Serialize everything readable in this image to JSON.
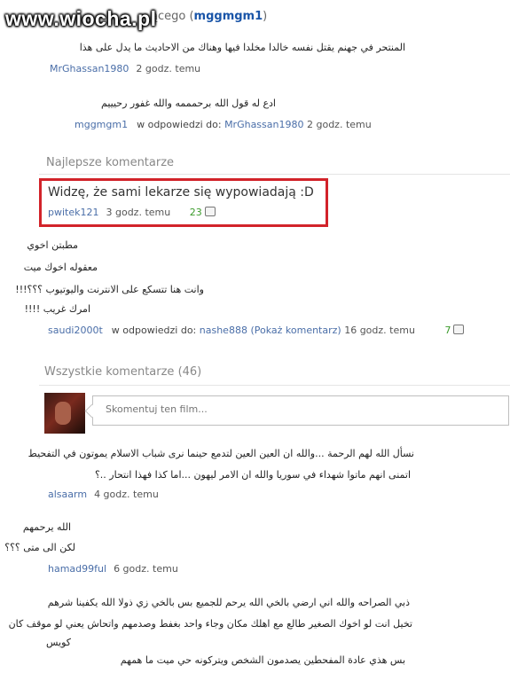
{
  "watermark": "www.wiocha.pl",
  "top": {
    "prefix": "ącego",
    "user": "mggmgm1",
    "paren_open": "(",
    "paren_close": ")"
  },
  "comments_top": [
    {
      "text": "المنتحر في جهنم يقتل نفسه خالدا مخلدا فيها وهناك من الاحاديث ما يدل على هذا",
      "user": "MrGhassan1980",
      "time": "2 godz. temu"
    },
    {
      "text": "ادع له قول الله برحمممه والله غفور رحيييم",
      "user": "mggmgm1",
      "reply_label": "w odpowiedzi do:",
      "reply_to": "MrGhassan1980",
      "time": "2 godz. temu"
    }
  ],
  "best": {
    "heading": "Najlepsze komentarze",
    "highlight": {
      "text": "Widzę, że sami lekarze się wypowiadają :D",
      "user": "pwitek121",
      "time": "3 godz. temu",
      "likes": "23"
    },
    "comment2": {
      "lines": [
        "مطبتن اخوي",
        "معقوله اخوك ميت",
        "وانت هنا تتسكع على الانترنت واليوتيوب ؟؟؟!!!",
        "امرك غريب !!!!"
      ],
      "user": "saudi2000t",
      "reply_label": "w odpowiedzi do:",
      "reply_to": "nashe888 (Pokaż komentarz)",
      "time": "16 godz. temu",
      "likes": "7"
    }
  },
  "all": {
    "heading": "Wszystkie komentarze (46)",
    "input_placeholder": "Skomentuj ten film...",
    "comments": [
      {
        "lines": [
          "نسأل الله لهم الرحمة ...والله ان العين العين لتدمع حينما نرى شباب الاسلام يموتون في التفحيط",
          "اتمنى انهم ماتوا شهداء في سوريا والله ان الامر ليهون ...اما كذا فهذا انتحار ..؟"
        ],
        "user": "alsaarm",
        "time": "4 godz. temu"
      },
      {
        "lines": [
          "الله يرحمهم",
          "لكن الى متى ؟؟؟"
        ],
        "user": "hamad99ful",
        "time": "6 godz. temu"
      },
      {
        "lines": [
          "ذبي الصراحه والله اني ارضي بالخي الله يرحم للجميع بس بالخي زي ذولا الله يكفينا شرهم",
          "تخيل انت لو اخوك الصغير طالع مع اهلك مكان وجاء واحد بغفط وصدمهم واتحاش يعني لو موقف كان",
          "كويس",
          "بس هذي عادة المفحطين يصدمون الشخص ويتركونه حي ميت ما همهم"
        ]
      }
    ]
  }
}
